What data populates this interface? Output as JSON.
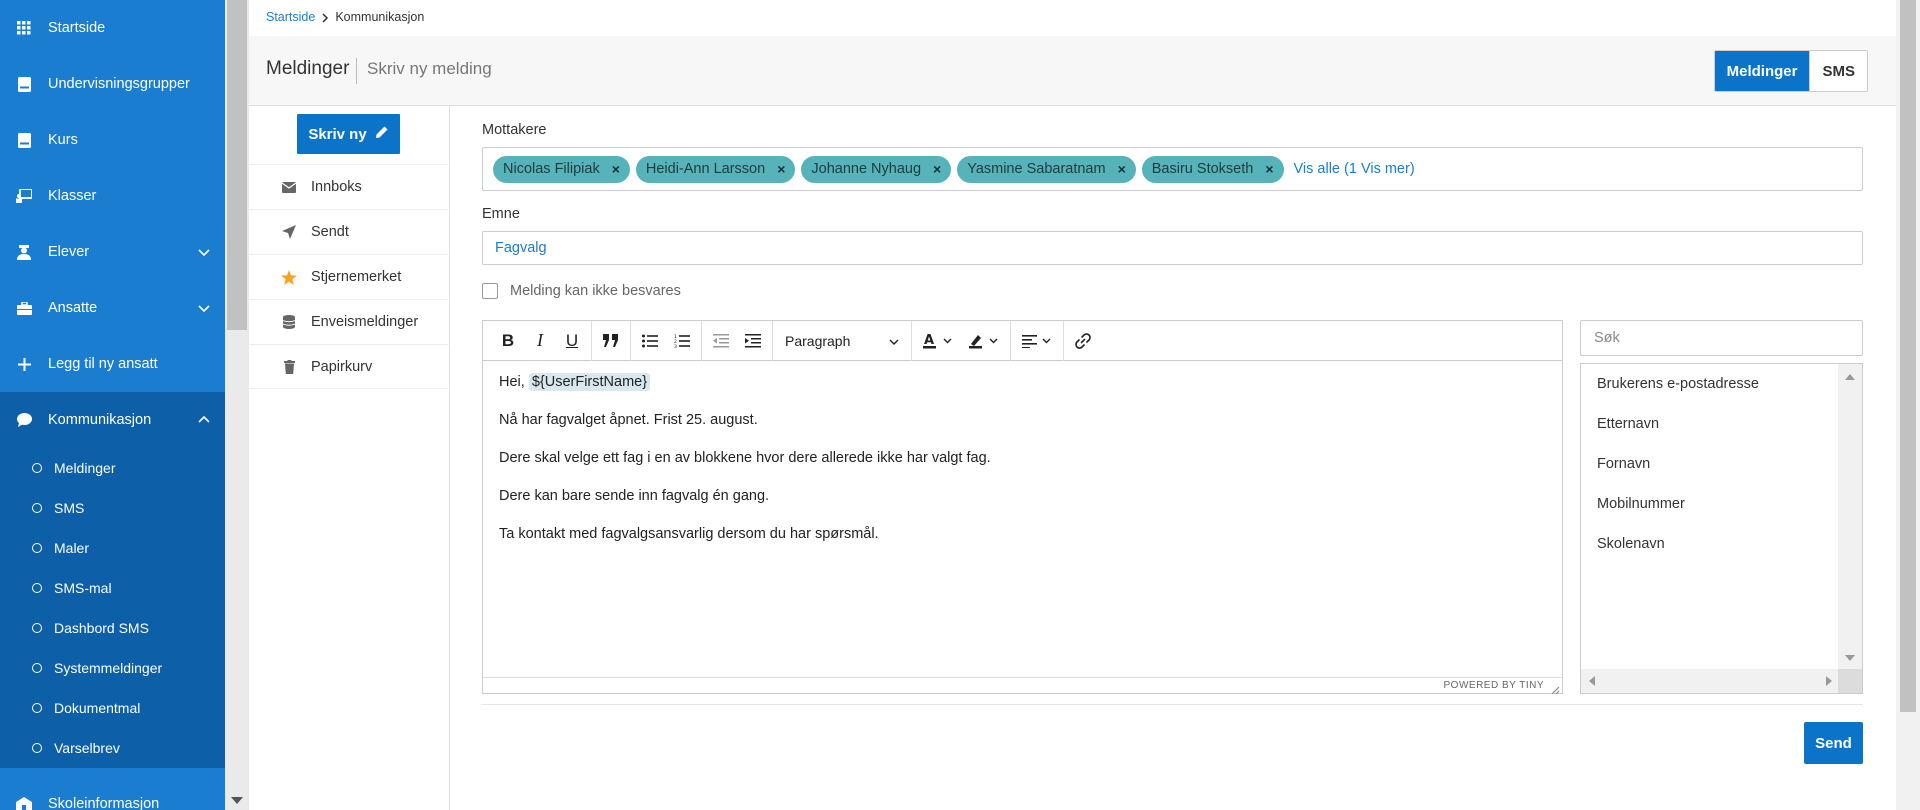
{
  "sidebar": {
    "items": [
      {
        "label": "Startside",
        "icon": "grid-icon"
      },
      {
        "label": "Undervisningsgrupper",
        "icon": "book-icon"
      },
      {
        "label": "Kurs",
        "icon": "book-icon"
      },
      {
        "label": "Klasser",
        "icon": "presentation-icon"
      },
      {
        "label": "Elever",
        "icon": "student-icon"
      },
      {
        "label": "Ansatte",
        "icon": "briefcase-icon"
      },
      {
        "label": "Legg til ny ansatt",
        "icon": "plus-icon"
      },
      {
        "label": "Kommunikasjon",
        "icon": "chat-icon"
      },
      {
        "label": "Skoleinformasjon",
        "icon": "school-icon"
      }
    ],
    "sub_items": [
      "Meldinger",
      "SMS",
      "Maler",
      "SMS-mal",
      "Dashbord SMS",
      "Systemmeldinger",
      "Dokumentmal",
      "Varselbrev"
    ]
  },
  "breadcrumb": {
    "home": "Startside",
    "current": "Kommunikasjon"
  },
  "header": {
    "title": "Meldinger",
    "subtitle": "Skriv ny melding",
    "toggle": {
      "active": "Meldinger",
      "inactive": "SMS"
    }
  },
  "leftnav": {
    "new_label": "Skriv ny",
    "items": [
      {
        "label": "Innboks",
        "icon": "envelope-icon"
      },
      {
        "label": "Sendt",
        "icon": "paper-plane-icon"
      },
      {
        "label": "Stjernemerket",
        "icon": "star-icon"
      },
      {
        "label": "Enveismeldinger",
        "icon": "database-icon"
      },
      {
        "label": "Papirkurv",
        "icon": "trash-icon"
      }
    ]
  },
  "form": {
    "recipients_label": "Mottakere",
    "recipients": [
      "Nicolas Filipiak",
      "Heidi-Ann Larsson",
      "Johanne Nyhaug",
      "Yasmine Sabaratnam",
      "Basiru Stokseth"
    ],
    "remove_symbol": "×",
    "show_all": "Vis alle (1 Vis mer)",
    "subject_label": "Emne",
    "subject_value": "Fagvalg",
    "no_reply_label": "Melding kan ikke besvares",
    "send_label": "Send"
  },
  "editor": {
    "block_format": "Paragraph",
    "greeting": "Hei,",
    "token": "${UserFirstName}",
    "paragraphs": [
      "Nå har fagvalget åpnet. Frist 25. august.",
      "Dere skal velge ett fag i en av blokkene hvor dere allerede ikke har valgt fag.",
      "Dere kan bare sende inn fagvalg én gang.",
      "Ta kontakt med fagvalgsansvarlig dersom du har spørsmål."
    ],
    "powered_by": "POWERED BY TINY"
  },
  "variables": {
    "search_placeholder": "Søk",
    "items": [
      "Brukerens e-postadresse",
      "Etternavn",
      "Fornavn",
      "Mobilnummer",
      "Skolenavn"
    ]
  },
  "colors": {
    "sidebar": "#1a7dd0",
    "sidebar_active_group": "#0d5fa8",
    "primary_button": "#0b74c8",
    "chip": "#56b3b9"
  }
}
